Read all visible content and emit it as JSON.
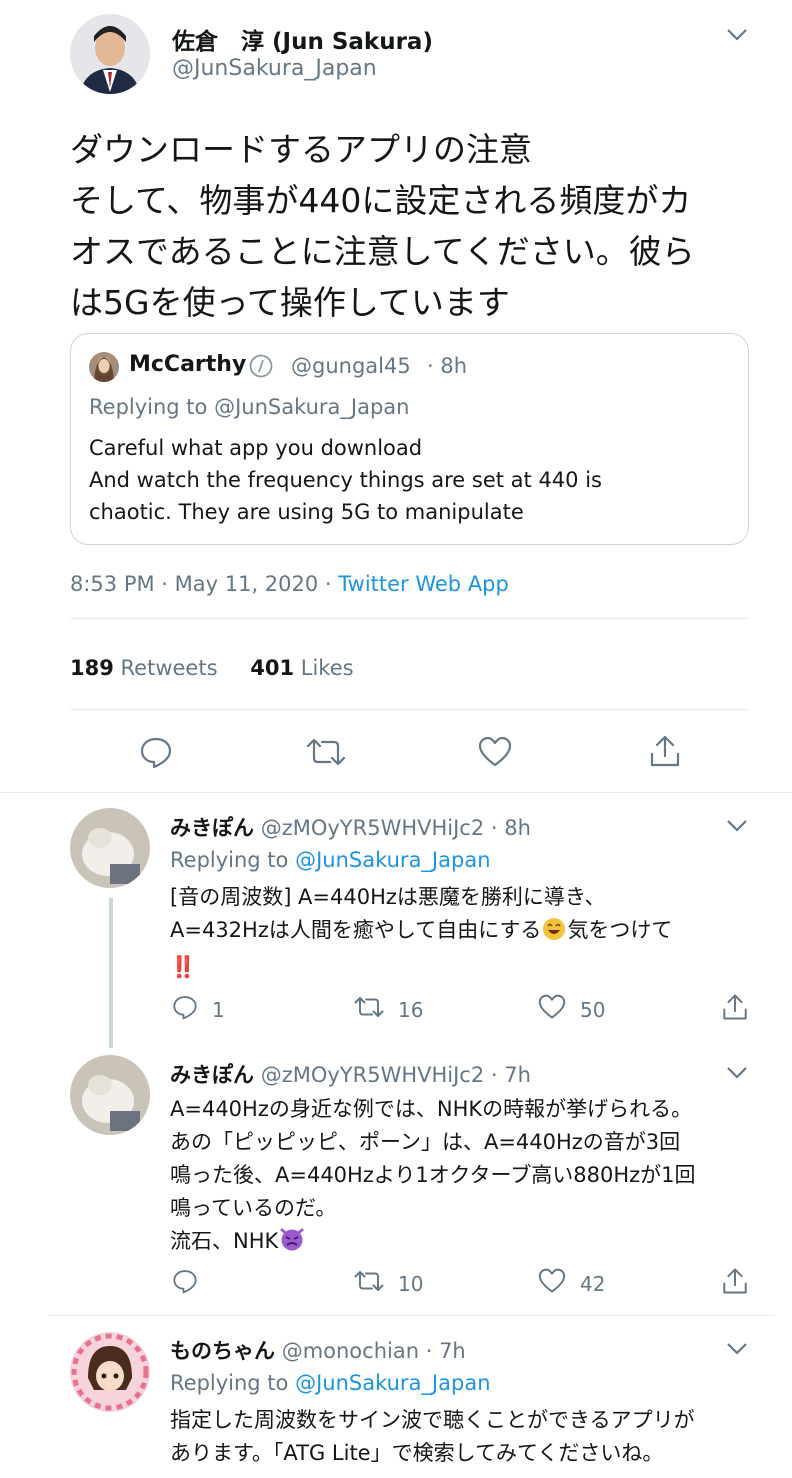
{
  "main_tweet": {
    "author_name": "佐倉　淳 (Jun Sakura)",
    "author_handle": "@JunSakura_Japan",
    "text_lines": [
      "ダウンロードするアプリの注意",
      "そして、物事が440に設定される頻度がカ",
      "オスであることに注意してください。彼ら",
      "は5Gを使って操作しています"
    ],
    "quoted": {
      "name": "McCarthy",
      "handle": "@gungal45",
      "time": "· 8h",
      "replying": "Replying to @JunSakura_Japan",
      "text_lines": [
        "Careful what app you download",
        "And watch the frequency things are set at 440 is",
        "chaotic. They are using 5G to manipulate"
      ]
    },
    "timestamp": "8:53 PM · May 11, 2020 ·",
    "source": "Twitter Web App",
    "retweets_count": "189",
    "retweets_label": "Retweets",
    "likes_count": "401",
    "likes_label": "Likes"
  },
  "replies": [
    {
      "name": "みきぽん",
      "handle": "@zMOyYR5WHVHiJc2",
      "time": "· 8h",
      "replying_prefix": "Replying to",
      "replying_handle": "@JunSakura_Japan",
      "text_lines": [
        "[音の周波数] A=440Hzは悪魔を勝利に導き、",
        "A=432Hzは人間を癒やして自由にする",
        "気をつけて",
        "‼️"
      ],
      "replies": "1",
      "retweets": "16",
      "likes": "50"
    },
    {
      "name": "みきぽん",
      "handle": "@zMOyYR5WHVHiJc2",
      "time": "· 7h",
      "text_lines": [
        "A=440Hzの身近な例では、NHKの時報が挙げられる。",
        "あの「ピッピッピ、ポーン」は、A=440Hzの音が3回",
        "鳴った後、A=440Hzより1オクターブ高い880Hzが1回",
        "鳴っているのだ。",
        "流石、NHK"
      ],
      "replies": "",
      "retweets": "10",
      "likes": "42"
    },
    {
      "name": "ものちゃん",
      "handle": "@monochian",
      "time": "· 7h",
      "replying_prefix": "Replying to",
      "replying_handle": "@JunSakura_Japan",
      "text_lines": [
        "指定した周波数をサイン波で聴くことができるアプリが",
        "あります。「ATG Lite」で検索してみてくださいね。"
      ]
    }
  ],
  "colors": {
    "text": "#14171a",
    "muted": "#657786",
    "link": "#1b95e0",
    "divider": "#e6ecf0",
    "alert": "#e0245e"
  }
}
